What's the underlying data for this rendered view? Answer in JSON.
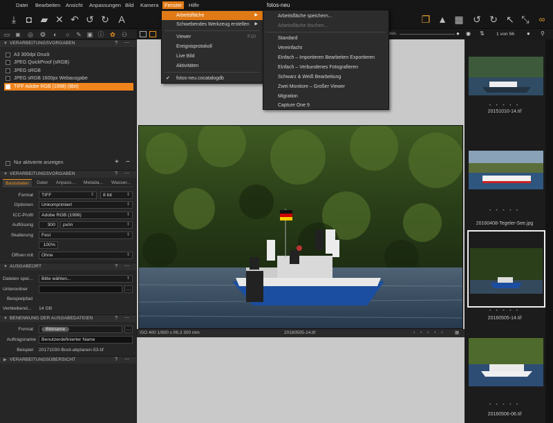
{
  "menubar": {
    "items": [
      "Datei",
      "Bearbeiten",
      "Ansicht",
      "Anpassungen",
      "Bild",
      "Kamera",
      "Fenster",
      "Hilfe"
    ],
    "active": "Fenster",
    "window_title": "fotos-neu"
  },
  "toolbar": {
    "icons": [
      "import-icon",
      "camera-icon",
      "folder-icon",
      "delete-icon",
      "undo-history-icon",
      "undo-icon",
      "redo-icon",
      "text-tool-icon"
    ],
    "right_icons": [
      "stack-icon",
      "warning-icon",
      "grid-icon",
      "rotate-left-icon",
      "rotate-right-icon",
      "cursor-icon",
      "zoom-icon",
      "glasses-icon"
    ]
  },
  "viewstrip": {
    "pass_label": "Pass.",
    "counter": "1 von 56"
  },
  "fenster_menu": {
    "items": [
      {
        "label": "Arbeitsfläche",
        "submenu": true,
        "highlight": true
      },
      {
        "label": "Schwebendes Werkzeug erstellen",
        "submenu": true
      },
      {
        "label": "Viewer",
        "shortcut": "F10"
      },
      {
        "label": "Ereignisprotokoll"
      },
      {
        "label": "Live Bild"
      },
      {
        "label": "Aktivitäten"
      },
      {
        "label": "fotos-neu.cocatalogdb",
        "checked": true
      }
    ]
  },
  "workspace_menu": {
    "items": [
      {
        "label": "Arbeitsfläche speichern..."
      },
      {
        "label": "Arbeitsfläche löschen...",
        "disabled": true
      },
      {
        "label": "Standard"
      },
      {
        "label": "Vereinfacht"
      },
      {
        "label": "Einfach – Importieren Bearbeiten Exportieren"
      },
      {
        "label": "Einfach – Verbundenes Fotografieren"
      },
      {
        "label": "Schwarz & Weiß Bearbeitung"
      },
      {
        "label": "Zwei Monitore – Großer Viewer"
      },
      {
        "label": "Migration"
      },
      {
        "label": "Capture One 9"
      }
    ]
  },
  "left": {
    "presets_header": "VERARBEITUNGSVORGABEN",
    "presets": [
      {
        "label": "A3 300dpi Druck",
        "checked": false
      },
      {
        "label": "JPEG QuickProof (sRGB)",
        "checked": false
      },
      {
        "label": "JPEG sRGB",
        "checked": false
      },
      {
        "label": "JPEG sRGB 1600px Webausgabe",
        "checked": false
      },
      {
        "label": "TIFF Adobe RGB (1998) (8bit)",
        "checked": true
      }
    ],
    "only_enabled": "Nur aktivierte anzeigen",
    "recipe_header": "VERARBEITUNGSVORGABEN",
    "subtabs": [
      "Basisdaten",
      "Datei",
      "Anpass...",
      "Metada...",
      "Wasser..."
    ],
    "format_label": "Format",
    "format_value": "TIFF",
    "bits_value": "8 bit",
    "options_label": "Optionen",
    "options_value": "Unkomprimiert",
    "icc_label": "ICC-Profil",
    "icc_value": "Adobe RGB (1998)",
    "res_label": "Auflösung",
    "res_value": "300",
    "res_unit": "px/in",
    "scale_label": "Skalierung",
    "scale_value": "Fest",
    "scale_pct": "100%",
    "open_label": "Öffnen mit",
    "open_value": "Ohne",
    "output_header": "AUSGABEORT",
    "files_label": "Dateien spei...",
    "files_value": "Bitte wählen...",
    "subfolder_label": "Unterordner",
    "example_path_label": "Beispielpfad",
    "remaining_label": "Verbleibend...",
    "remaining_value": "14 GB",
    "naming_header": "BENENNUNG DER AUSGABEDATEIEN",
    "naming_format_label": "Format",
    "naming_token": "Bildname",
    "job_label": "Auftragsname",
    "job_value": "Benutzerdefinierter Name",
    "sample_label": "Beispiel",
    "sample_value": "20171030-Boot-abplanen-53.tif",
    "summary_header": "VERARBEITUNGSÜBERSICHT"
  },
  "photo": {
    "info": "ISO 400  1/800 s  f/6.3  300 mm",
    "filename": "20160505-14.tif"
  },
  "thumbs": [
    {
      "caption": "20151010-14.tif"
    },
    {
      "caption": "20160408-Tegeler-See.jpg"
    },
    {
      "caption": "20160505-14.tif",
      "selected": true
    },
    {
      "caption": "20160506-06.tif"
    }
  ],
  "colors": {
    "accent": "#f0841c",
    "panel": "#262626",
    "canvas": "#c9c9c9"
  }
}
